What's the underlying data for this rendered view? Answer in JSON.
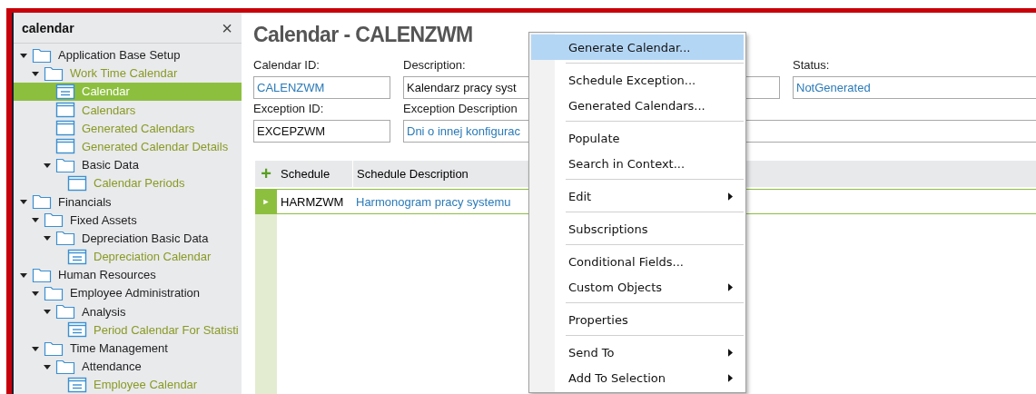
{
  "sidebar": {
    "search": {
      "value": "calendar",
      "clear": "×"
    },
    "tree": [
      {
        "label": "Application Base Setup",
        "kind": "folder",
        "expanded": true,
        "match": false,
        "selected": false,
        "children": [
          {
            "label": "Work Time Calendar",
            "kind": "folder",
            "expanded": true,
            "match": true,
            "selected": false,
            "children": [
              {
                "label": "Calendar",
                "kind": "form",
                "match": true,
                "selected": true
              },
              {
                "label": "Calendars",
                "kind": "window",
                "match": true,
                "selected": false
              },
              {
                "label": "Generated Calendars",
                "kind": "window",
                "match": true,
                "selected": false
              },
              {
                "label": "Generated Calendar Details",
                "kind": "window",
                "match": true,
                "selected": false
              },
              {
                "label": "Basic Data",
                "kind": "folder",
                "expanded": true,
                "match": false,
                "selected": false,
                "children": [
                  {
                    "label": "Calendar Periods",
                    "kind": "window",
                    "match": true,
                    "selected": false
                  }
                ]
              }
            ]
          }
        ]
      },
      {
        "label": "Financials",
        "kind": "folder",
        "expanded": true,
        "match": false,
        "selected": false,
        "children": [
          {
            "label": "Fixed Assets",
            "kind": "folder",
            "expanded": true,
            "match": false,
            "selected": false,
            "children": [
              {
                "label": "Depreciation Basic Data",
                "kind": "folder",
                "expanded": true,
                "match": false,
                "selected": false,
                "children": [
                  {
                    "label": "Depreciation Calendar",
                    "kind": "form",
                    "match": true,
                    "selected": false
                  }
                ]
              }
            ]
          }
        ]
      },
      {
        "label": "Human Resources",
        "kind": "folder",
        "expanded": true,
        "match": false,
        "selected": false,
        "children": [
          {
            "label": "Employee Administration",
            "kind": "folder",
            "expanded": true,
            "match": false,
            "selected": false,
            "children": [
              {
                "label": "Analysis",
                "kind": "folder",
                "expanded": true,
                "match": false,
                "selected": false,
                "children": [
                  {
                    "label": "Period Calendar For Statisti",
                    "kind": "form",
                    "match": true,
                    "selected": false
                  }
                ]
              }
            ]
          },
          {
            "label": "Time Management",
            "kind": "folder",
            "expanded": true,
            "match": false,
            "selected": false,
            "children": [
              {
                "label": "Attendance",
                "kind": "folder",
                "expanded": true,
                "match": false,
                "selected": false,
                "children": [
                  {
                    "label": "Employee Calendar",
                    "kind": "form",
                    "match": true,
                    "selected": false
                  }
                ]
              }
            ]
          }
        ]
      }
    ]
  },
  "page": {
    "title": "Calendar - CALENZWM",
    "fields": [
      {
        "label": "Calendar ID:",
        "value": "CALENZWM",
        "link": true
      },
      {
        "label": "Description:",
        "value": "Kalendarz pracy syst",
        "link": false
      },
      {
        "label": "Status:",
        "value": "NotGenerated",
        "link": true
      },
      {
        "label": "Exception ID:",
        "value": "EXCEPZWM",
        "link": false
      },
      {
        "label": "Exception Description",
        "value": "Dni o innej konfigurac",
        "link": true
      }
    ]
  },
  "table": {
    "add": "+",
    "columns": [
      "Schedule",
      "Schedule Description"
    ],
    "rows": [
      {
        "cells": [
          "HARMZWM",
          "Harmonogram pracy systemu"
        ],
        "selected": true,
        "marker": "►"
      }
    ]
  },
  "context_menu": {
    "groups": [
      [
        {
          "label": "Generate Calendar...",
          "submenu": false,
          "selected": true
        }
      ],
      [
        {
          "label": "Schedule Exception...",
          "submenu": false,
          "selected": false
        },
        {
          "label": "Generated Calendars...",
          "submenu": false,
          "selected": false
        }
      ],
      [
        {
          "label": "Populate",
          "submenu": false,
          "selected": false
        },
        {
          "label": "Search in Context...",
          "submenu": false,
          "selected": false
        }
      ],
      [
        {
          "label": "Edit",
          "submenu": true,
          "selected": false
        }
      ],
      [
        {
          "label": "Subscriptions",
          "submenu": false,
          "selected": false
        }
      ],
      [
        {
          "label": "Conditional Fields...",
          "submenu": false,
          "selected": false
        },
        {
          "label": "Custom Objects",
          "submenu": true,
          "selected": false
        }
      ],
      [
        {
          "label": "Properties",
          "submenu": false,
          "selected": false
        }
      ],
      [
        {
          "label": "Send To",
          "submenu": true,
          "selected": false
        },
        {
          "label": "Add To Selection",
          "submenu": true,
          "selected": false
        }
      ]
    ]
  }
}
